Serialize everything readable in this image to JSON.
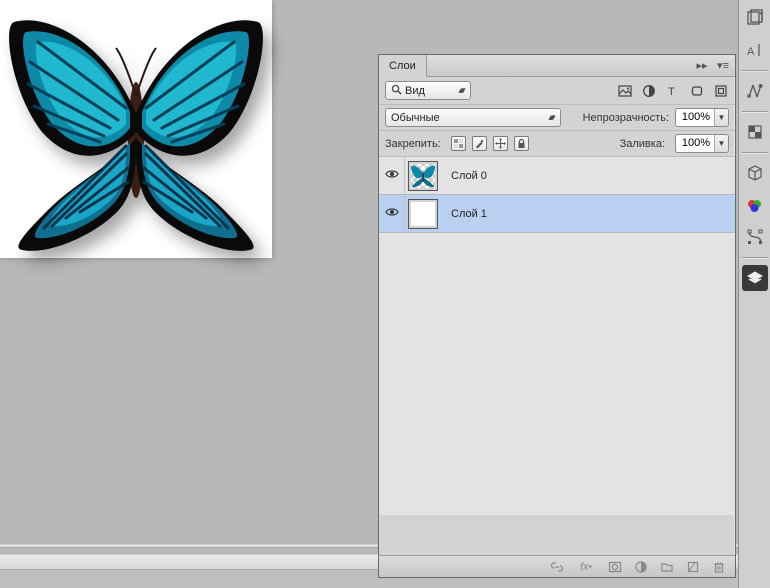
{
  "panel": {
    "title": "Слои",
    "filter_label": "Вид",
    "blend_mode": "Обычные",
    "opacity_label": "Непрозрачность:",
    "opacity_value": "100%",
    "fill_label": "Заливка:",
    "fill_value": "100%",
    "lock_label": "Закрепить:"
  },
  "layers": [
    {
      "name": "Слой 0",
      "visible": true,
      "selected": false,
      "thumb": "butterfly"
    },
    {
      "name": "Слой 1",
      "visible": true,
      "selected": true,
      "thumb": "white"
    }
  ],
  "toolbar_right": {
    "items": [
      "history-icon",
      "character-icon",
      "sep",
      "adjustments-icon",
      "sep",
      "styles-icon",
      "sep",
      "3d-icon",
      "color-icon",
      "paths-icon",
      "sep",
      "layers-icon"
    ],
    "active": "layers-icon"
  },
  "icons": {
    "filter_row": [
      "image-filter-icon",
      "adjust-filter-icon",
      "type-filter-icon",
      "shape-filter-icon",
      "smart-filter-icon"
    ],
    "lock_row": [
      "lock-pixels-icon",
      "lock-brush-icon",
      "lock-move-icon",
      "lock-all-icon"
    ],
    "footer": [
      "link-icon",
      "fx-icon",
      "mask-icon",
      "adjustment-layer-icon",
      "group-icon",
      "new-layer-icon",
      "trash-icon"
    ]
  }
}
